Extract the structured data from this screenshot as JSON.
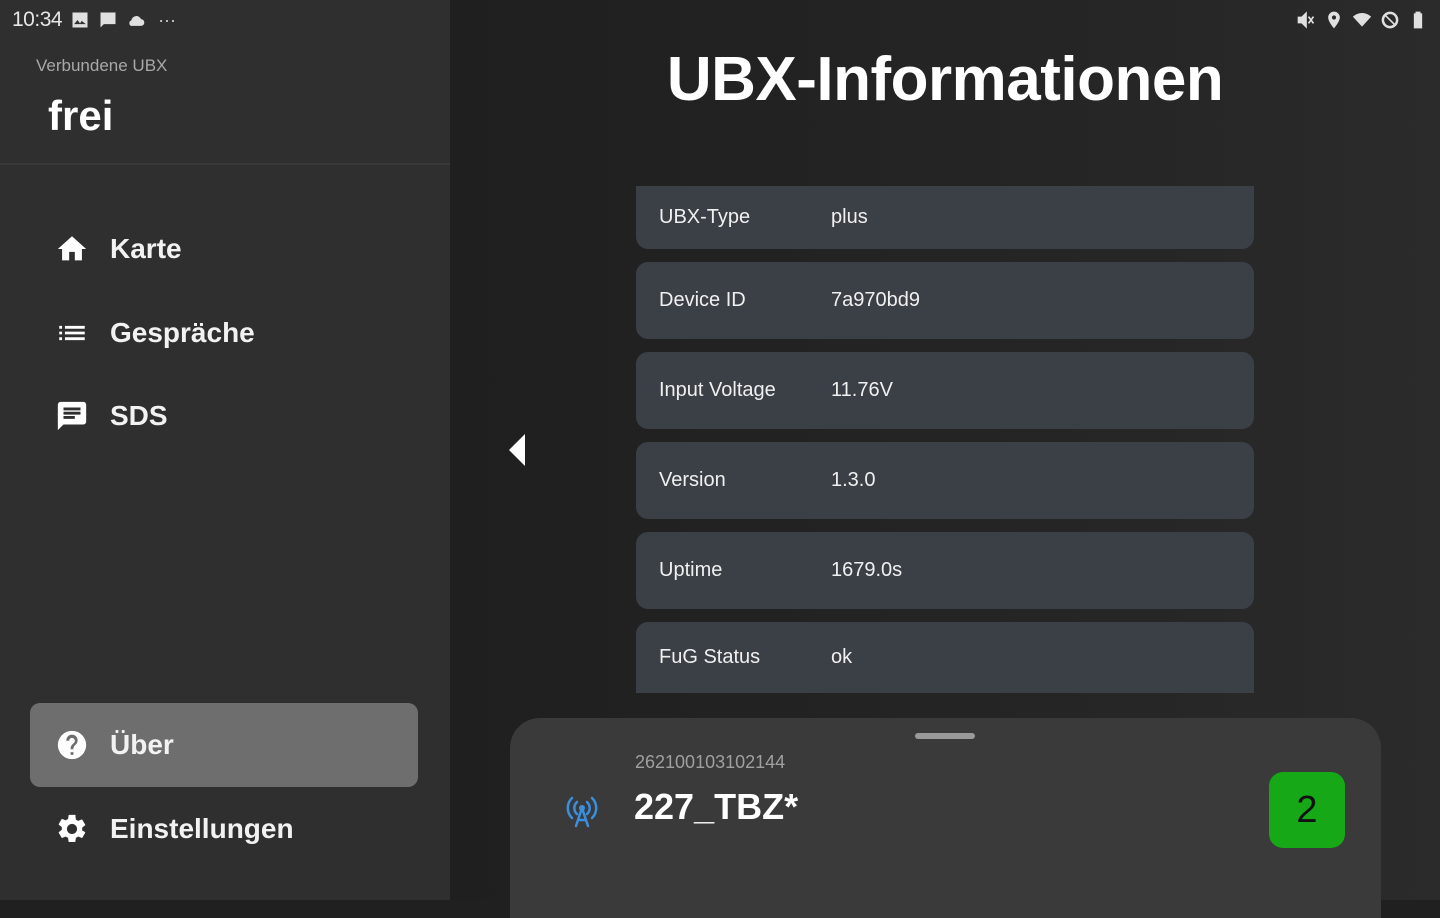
{
  "status_bar": {
    "time": "10:34",
    "left_icons": [
      "image-icon",
      "message-icon",
      "cloud-icon"
    ],
    "overflow": "···",
    "right_icons": [
      "mute-icon",
      "location-icon",
      "wifi-icon",
      "dnd-icon",
      "battery-icon"
    ]
  },
  "drawer": {
    "subtitle": "Verbundene UBX",
    "title": "frei",
    "items": [
      {
        "label": "Karte",
        "icon": "home-icon"
      },
      {
        "label": "Gespräche",
        "icon": "list-icon"
      },
      {
        "label": "SDS",
        "icon": "chat-icon"
      }
    ],
    "bottom_items": [
      {
        "label": "Über",
        "icon": "help-icon",
        "active": true
      },
      {
        "label": "Einstellungen",
        "icon": "gear-icon"
      }
    ]
  },
  "main": {
    "title": "UBX-Informationen",
    "info": [
      {
        "key": "UBX-Type",
        "value": "plus"
      },
      {
        "key": "Device ID",
        "value": "7a970bd9"
      },
      {
        "key": "Input Voltage",
        "value": "11.76V"
      },
      {
        "key": "Version",
        "value": "1.3.0"
      },
      {
        "key": "Uptime",
        "value": "1679.0s"
      },
      {
        "key": "FuG Status",
        "value": "ok"
      }
    ]
  },
  "sheet": {
    "id": "262100103102144",
    "name": "227_TBZ*",
    "badge": "2",
    "badge_color": "#17a817",
    "icon": "radio-tower-icon",
    "icon_color": "#3b8fe0"
  }
}
